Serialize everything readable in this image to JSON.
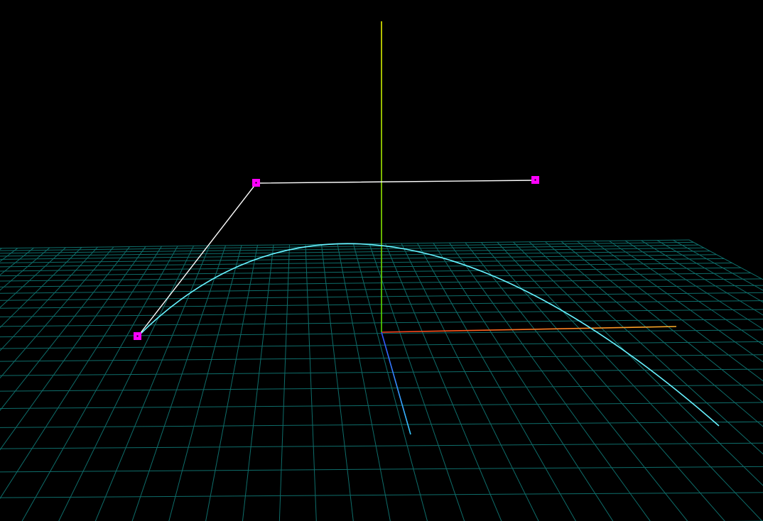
{
  "viewport": {
    "background": "#000000"
  },
  "grid": {
    "color": "#0e6d6a",
    "visible": true
  },
  "axes": {
    "x_color_origin": "#ff3a1a",
    "x_color_end": "#ffb028",
    "y_color_origin": "#4fd800",
    "y_color_end": "#e6f000",
    "z_color_origin": "#3050ff",
    "z_color_end": "#38c8ff"
  },
  "curve": {
    "type": "quadratic-bezier",
    "color": "#66f2ff"
  },
  "control_polygon": {
    "color": "#ffffff"
  },
  "control_points": {
    "color": "#ff00ff",
    "count": 3
  }
}
